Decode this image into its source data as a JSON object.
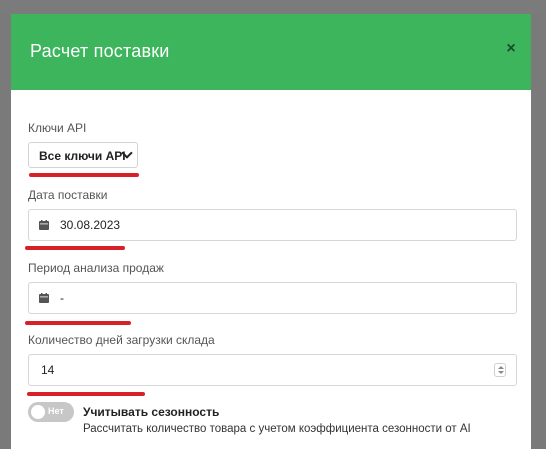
{
  "modal": {
    "title": "Расчет поставки",
    "close_label": "×"
  },
  "api_keys": {
    "label": "Ключи API",
    "selected": "Все ключи API"
  },
  "supply_date": {
    "label": "Дата поставки",
    "value": "30.08.2023"
  },
  "sales_period": {
    "label": "Период анализа продаж",
    "value": "-"
  },
  "warehouse_days": {
    "label": "Количество дней загрузки склада",
    "value": "14"
  },
  "seasonality": {
    "toggle_label": "Нет",
    "title": "Учитывать сезонность",
    "description": "Рассчитать количество товара с учетом коэффициента сезонности от AI"
  },
  "colors": {
    "header": "#3cb55c",
    "annotation": "#d62128"
  },
  "icons": [
    "close-icon",
    "chevron-down-icon",
    "calendar-icon",
    "spinner-icon"
  ]
}
